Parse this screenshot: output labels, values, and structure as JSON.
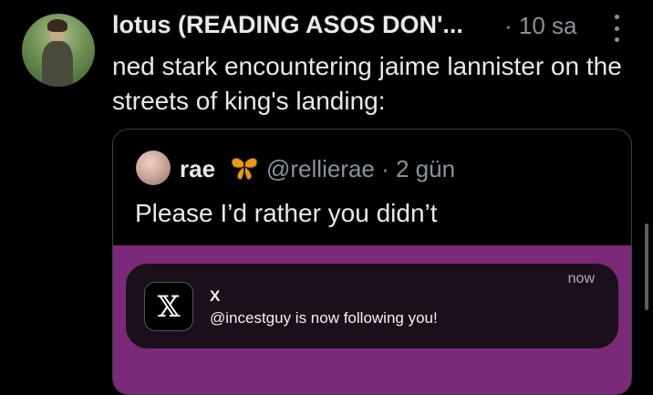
{
  "tweet": {
    "author_name": "lotus (READING ASOS DON'...",
    "meta": "· 10 sa",
    "text": "ned stark encountering jaime lannister on the streets of king's landing:"
  },
  "quoted": {
    "name": "rae",
    "emoji_icon": "butterfly-icon",
    "handle_meta": "@rellierae · 2 gün",
    "text": "Please I’d rather you didn’t",
    "image": {
      "background_color": "#7a2a78",
      "notification": {
        "app_title": "X",
        "message": "@incestguy is now following you!",
        "time": "now",
        "logo_icon": "x-logo-icon",
        "logo_glyph": "𝕏"
      }
    }
  },
  "colors": {
    "background": "#000000",
    "text_primary": "#e7e9ea",
    "text_secondary": "#8b9199",
    "quote_border": "#3a3f44"
  }
}
